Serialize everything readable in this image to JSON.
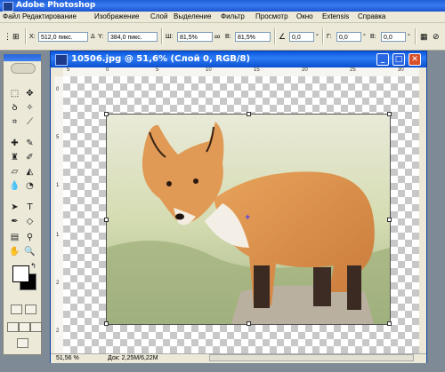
{
  "app": {
    "title": "Adobe Photoshop"
  },
  "menu": [
    "Файл",
    "Редактирование",
    "Изображение",
    "Слой",
    "Выделение",
    "Фильтр",
    "Просмотр",
    "Окно",
    "Extensis",
    "Справка"
  ],
  "options": {
    "x_label": "X:",
    "x_value": "512,0 пикс.",
    "y_label": "Y:",
    "y_value": "384,0 пикс.",
    "w_label": "Ш:",
    "w_value": "81,5%",
    "h_label": "В:",
    "h_value": "81,5%",
    "angle_value": "0,0",
    "angle_unit": "°",
    "g_label": "Г:",
    "g_value": "0,0",
    "v_label": "В:",
    "v_value": "0,0",
    "g_unit": "°",
    "v_unit": "°",
    "delta_symbol": "Δ"
  },
  "document": {
    "title": "10506.jpg @ 51,6% (Слой 0, RGB/8)",
    "minimize": "_",
    "maximize": "□",
    "close": "✕",
    "zoom": "51,56 %",
    "doc_info": "Док: 2,25M/6,22M",
    "ruler_top": [
      "5",
      "0",
      "5",
      "10",
      "15",
      "20",
      "25",
      "30"
    ],
    "ruler_left": [
      "0",
      "5",
      "1",
      "1",
      "2",
      "2"
    ]
  },
  "colors": {
    "app_blue": "#1f5fd8",
    "chrome": "#ece9d8",
    "workspace": "#7e8a96"
  }
}
